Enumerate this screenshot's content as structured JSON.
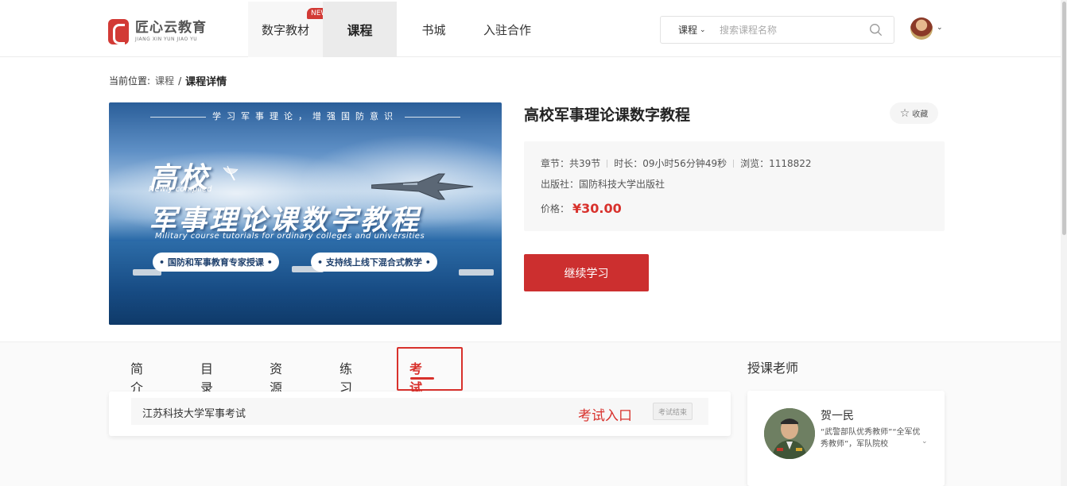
{
  "header": {
    "logo_cn": "匠心云教育",
    "logo_en": "JIANG XIN YUN JIAO YU",
    "nav": [
      {
        "label": "数字教材",
        "badge": "NEW"
      },
      {
        "label": "课程"
      },
      {
        "label": "书城"
      },
      {
        "label": "入驻合作"
      }
    ],
    "search": {
      "type_label": "课程",
      "placeholder": "搜索课程名称"
    }
  },
  "breadcrumb": {
    "prefix": "当前位置:",
    "link": "课程",
    "separator": "/",
    "current": "课程详情"
  },
  "cover": {
    "slogan": "学习军事理论，增强国防意识",
    "title_line1": "高校",
    "newly": "Newly compiled",
    "title_line2": "军事理论课数字教程",
    "subtitle_en": "Military course tutorials for ordinary colleges and universities",
    "pill1": "• 国防和军事教育专家授课 •",
    "pill2": "• 支持线上线下混合式教学 •"
  },
  "course": {
    "title": "高校军事理论课数字教程",
    "favorite_label": "收藏",
    "chapters": "章节：共39节",
    "duration": "时长：09小时56分钟49秒",
    "views": "浏览：1118822",
    "publisher": "出版社：国防科技大学出版社",
    "price_label": "价格：",
    "price": "¥30.00",
    "continue_label": "继续学习"
  },
  "tabs": [
    {
      "label": "简介"
    },
    {
      "label": "目录"
    },
    {
      "label": "资源"
    },
    {
      "label": "练习"
    },
    {
      "label": "考试"
    }
  ],
  "exam": {
    "name": "江苏科技大学军事考试",
    "entry_label": "考试入口",
    "status": "考试结束"
  },
  "teacher": {
    "heading": "授课老师",
    "name": "贺一民",
    "desc": "“武警部队优秀教师”“全军优秀教师”，军队院校"
  },
  "colors": {
    "accent": "#d8312c",
    "button": "#cc2f2f"
  }
}
